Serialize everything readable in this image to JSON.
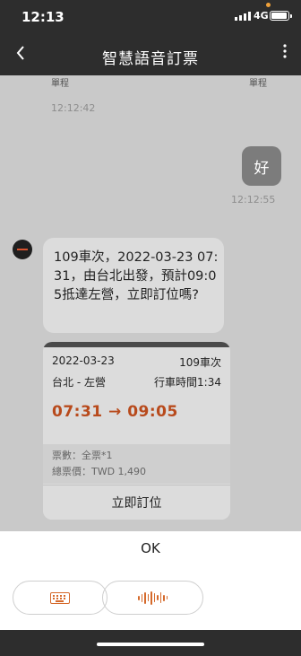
{
  "status": {
    "time": "12:13",
    "network": "4G"
  },
  "header": {
    "back_icon": "‹",
    "title": "智慧語音訂票",
    "more_icon": "⋮"
  },
  "chat": {
    "partial_left": "單程",
    "partial_right": "單程",
    "ts_top": "12:12:42",
    "user_message": "好",
    "user_time": "12:12:55",
    "bot_message": "109車次，2022-03-23 07:31，由台北出發，預計09:05抵達左營，立即訂位嗎?",
    "card": {
      "date": "2022-03-23",
      "train": "109車次",
      "route": "台北 - 左營",
      "duration": "行車時間1:34",
      "times": "07:31 → 09:05",
      "tickets": "票數：全票*1",
      "total": "總票價：TWD 1,490",
      "book_button": "立即訂位"
    },
    "accent_color": "#b84a1c"
  },
  "bottom": {
    "recognized": "OK",
    "keyboard_icon": "keyboard-icon",
    "mic_icon": "voice-wave-icon"
  }
}
